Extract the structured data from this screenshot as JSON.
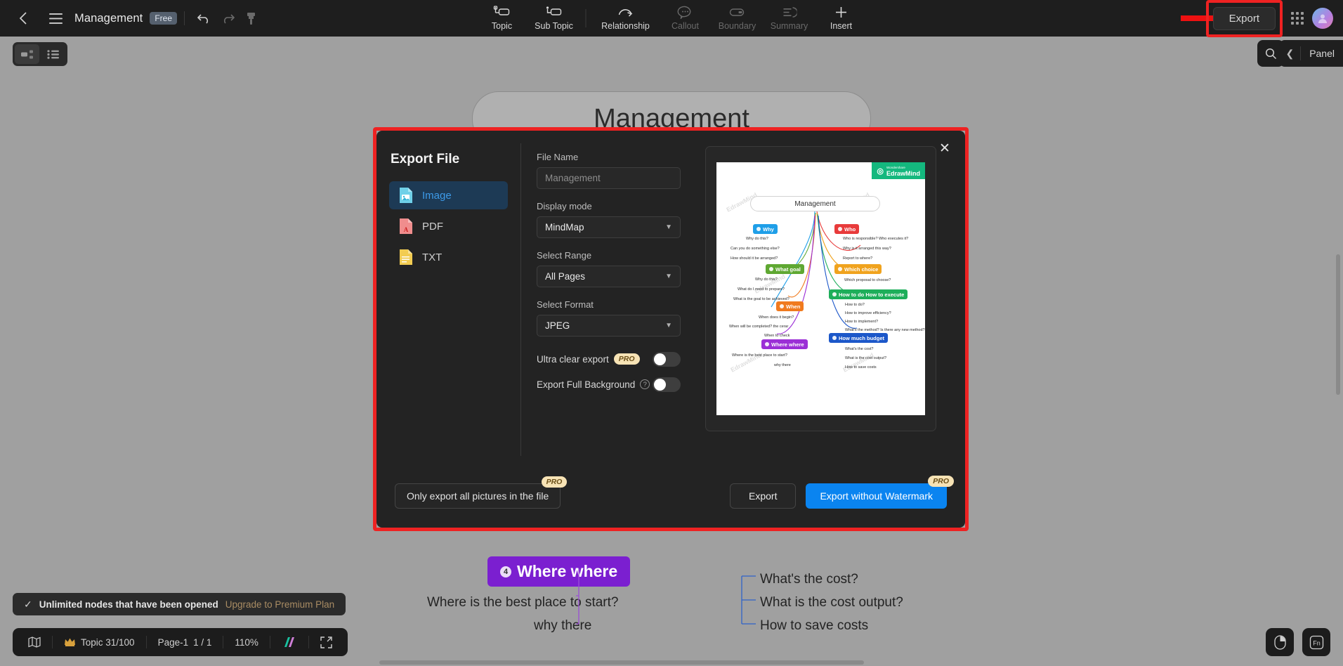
{
  "topbar": {
    "back_icon": "chevron-left-icon",
    "menu_icon": "hamburger-menu-icon",
    "doc_title": "Management",
    "plan_badge": "Free",
    "undo_icon": "undo-icon",
    "redo_icon": "redo-icon",
    "format_painter_icon": "format-painter-icon",
    "tools": [
      {
        "label": "Topic",
        "icon": "topic-icon",
        "dim": false
      },
      {
        "label": "Sub Topic",
        "icon": "sub-topic-icon",
        "dim": false
      },
      {
        "label": "Relationship",
        "icon": "relationship-icon",
        "dim": false
      },
      {
        "label": "Callout",
        "icon": "callout-icon",
        "dim": true
      },
      {
        "label": "Boundary",
        "icon": "boundary-icon",
        "dim": true
      },
      {
        "label": "Summary",
        "icon": "summary-icon",
        "dim": true
      },
      {
        "label": "Insert",
        "icon": "insert-plus-icon",
        "dim": false
      }
    ],
    "export_label": "Export",
    "apps_icon": "grid-apps-icon",
    "avatar_icon": "user-avatar",
    "arrow_annotation": "red-arrow-pointing-right"
  },
  "right_rail": {
    "search_icon": "search-icon",
    "collapse_icon": "chevron-left-icon",
    "panel_label": "Panel"
  },
  "view_toggle": {
    "mindmap_icon": "mindmap-view-icon",
    "outline_icon": "outline-list-view-icon"
  },
  "toast": {
    "check_icon": "check-icon",
    "message": "Unlimited nodes that have been opened",
    "link": "Upgrade to Premium Plan"
  },
  "statusbar": {
    "map_icon": "map-overview-icon",
    "crown_icon": "crown-icon",
    "topic_count": "Topic 31/100",
    "page_label": "Page-1",
    "page_number": "1 / 1",
    "zoom": "110%",
    "theme_icon": "color-theme-icon",
    "fullscreen_icon": "fullscreen-icon"
  },
  "fabs": [
    {
      "icon": "mouse-mode-icon"
    },
    {
      "icon": "fn-shortcut-icon"
    }
  ],
  "canvas": {
    "root": "Management",
    "nodes": [
      {
        "label": "Where where",
        "num": "4",
        "color": "#7b1fd0"
      }
    ],
    "leaves": [
      "Where is the best place to start?",
      "why there",
      "What's the cost?",
      "What is the cost output?",
      "How to save costs"
    ]
  },
  "modal": {
    "title": "Export File",
    "close_icon": "close-icon",
    "formats": [
      {
        "label": "Image",
        "icon": "image-file-icon",
        "active": true
      },
      {
        "label": "PDF",
        "icon": "pdf-file-icon",
        "active": false
      },
      {
        "label": "TXT",
        "icon": "txt-file-icon",
        "active": false
      }
    ],
    "fields": {
      "file_name_label": "File Name",
      "file_name_placeholder": "Management",
      "file_name_value": "",
      "display_mode_label": "Display mode",
      "display_mode_value": "MindMap",
      "select_range_label": "Select Range",
      "select_range_value": "All Pages",
      "select_format_label": "Select Format",
      "select_format_value": "JPEG"
    },
    "toggles": [
      {
        "label": "Ultra clear export",
        "pro": "PRO",
        "on": false,
        "help": false
      },
      {
        "label": "Export Full Background",
        "pro": "",
        "on": false,
        "help": true
      }
    ],
    "buttons": {
      "only_pictures": "Only export all pictures in the file",
      "only_pictures_pro": "PRO",
      "export": "Export",
      "export_no_watermark": "Export without Watermark",
      "export_no_watermark_pro": "PRO"
    },
    "preview": {
      "brand_top": "Wondershare",
      "brand": "EdrawMind",
      "watermark": "EdrawMind",
      "watermark_small": "Wondershare",
      "root": "Management",
      "branches": [
        {
          "label": "Why",
          "num": "1",
          "color": "#1f9fe8",
          "children": [
            "Why do this?",
            "Can you do something else?",
            "How should it be arranged?"
          ]
        },
        {
          "label": "Who",
          "num": "5",
          "color": "#e83b3b",
          "children": [
            "Who is responsible? Who executes it?",
            "Why is it arranged this way?",
            "Report to where?"
          ]
        },
        {
          "label": "What goal",
          "num": "2",
          "color": "#5fa832",
          "children": [
            "Why do this?",
            "What do I need to prepare?",
            "What is the goal to be achieved?"
          ]
        },
        {
          "label": "Which choice",
          "num": "6",
          "color": "#f0a31e",
          "children": [
            "Which proposal to choose?"
          ]
        },
        {
          "label": "When",
          "num": "3",
          "color": "#f07a1e",
          "children": [
            "When does it begin?",
            "When will be completed? the cerar",
            "When to check"
          ]
        },
        {
          "label": "How to do How to execute",
          "num": "7",
          "color": "#1eae5a",
          "children": [
            "How to do?",
            "How to improve efficiency?",
            "How to implement?",
            "What's the method? Is there any new method?"
          ]
        },
        {
          "label": "Where where",
          "num": "4",
          "color": "#9b2fd6",
          "children": [
            "Where is the best place to start?",
            "why there"
          ]
        },
        {
          "label": "How much budget",
          "num": "8",
          "color": "#1c57c9",
          "children": [
            "What's the cost?",
            "What is the cost output?",
            "How to save costs"
          ]
        }
      ]
    }
  },
  "colors": {
    "accent": "#0a84f0",
    "highlight": "#ee2222",
    "active_item_bg": "#1d3a55",
    "active_item_fg": "#3d9ae8",
    "pro_badge_bg": "#f7e3b5"
  }
}
